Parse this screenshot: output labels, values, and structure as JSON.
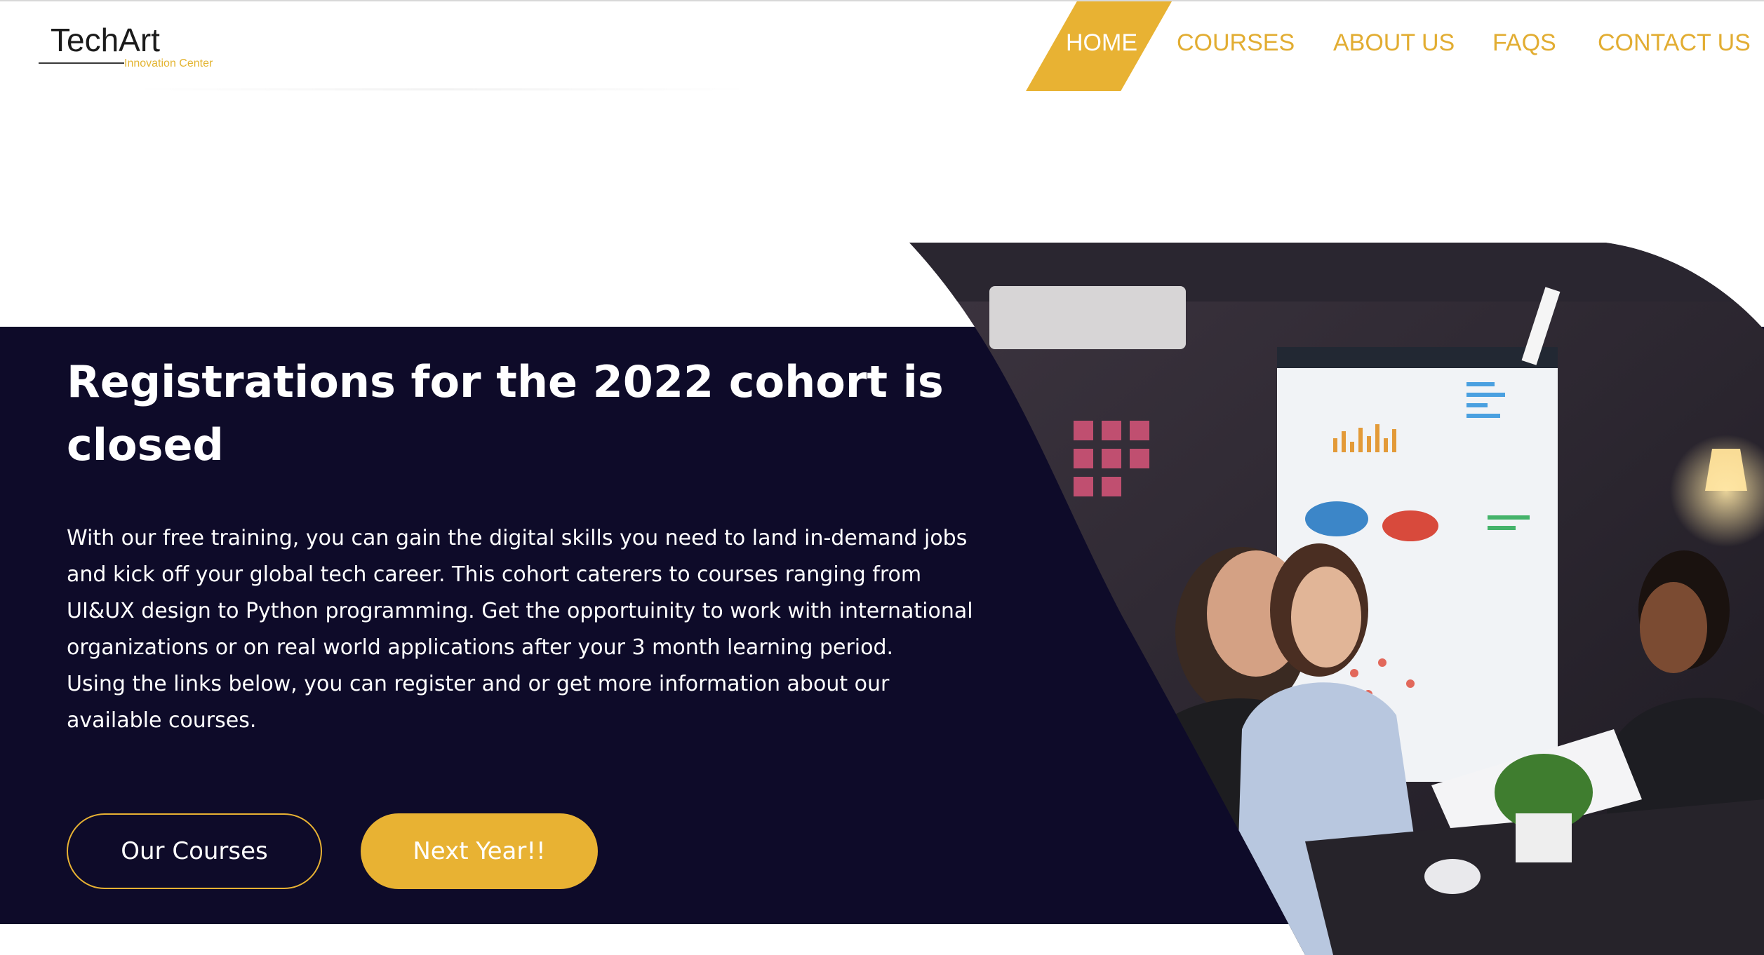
{
  "brand": {
    "name": "TechArt",
    "tagline": "Innovation Center"
  },
  "nav": {
    "items": [
      {
        "label": "HOME",
        "active": true
      },
      {
        "label": "COURSES"
      },
      {
        "label": "ABOUT US"
      },
      {
        "label": "FAQS"
      },
      {
        "label": "CONTACT US"
      }
    ]
  },
  "hero": {
    "title": "Registrations for the 2022 cohort is closed",
    "paragraphs": [
      "With our free training, you can gain the digital skills you need to land in-demand jobs and kick off your global tech career. This cohort caterers to courses ranging from UI&UX design to Python programming. Get the opportuinity to work with international organizations or on real world applications after your 3 month learning period.",
      "Using the links below, you can register and or get more information about our available courses."
    ],
    "buttons": {
      "primary_outline": "Our Courses",
      "secondary_fill": "Next Year!!"
    }
  },
  "colors": {
    "accent": "#e8b233",
    "hero_background": "#0e0b29",
    "text_light": "#ffffff"
  }
}
